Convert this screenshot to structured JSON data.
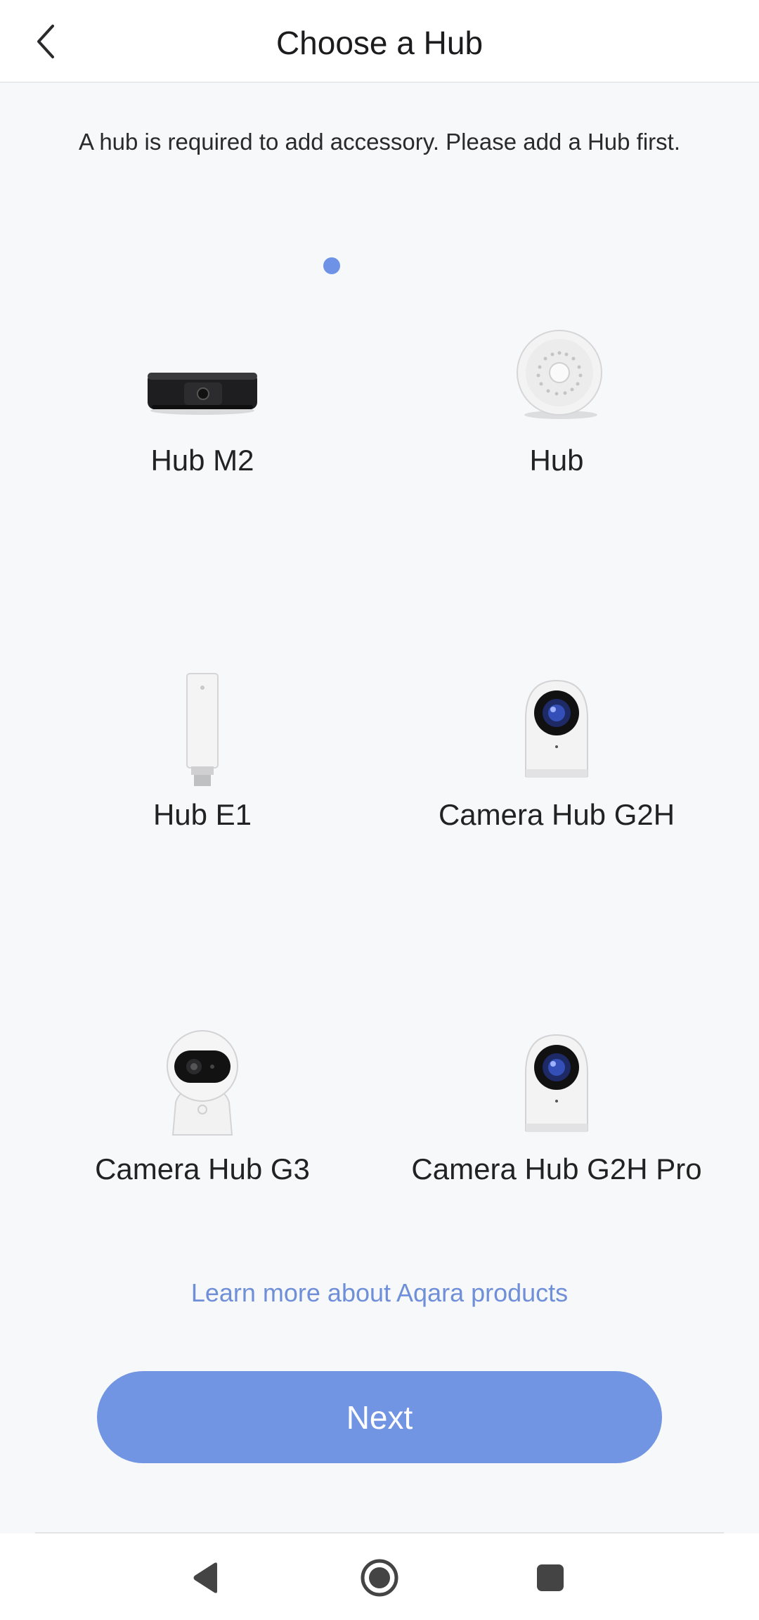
{
  "header": {
    "title": "Choose a Hub",
    "back_icon": "chevron-left-icon"
  },
  "notice": "A hub is required to add accessory. Please add a Hub first.",
  "hubs": [
    {
      "name": "Hub M2",
      "icon": "hub-m2-device-image",
      "selected": true
    },
    {
      "name": "Hub",
      "icon": "hub-device-image",
      "selected": false
    },
    {
      "name": "Hub E1",
      "icon": "hub-e1-dongle-image",
      "selected": false
    },
    {
      "name": "Camera Hub G2H",
      "icon": "camera-hub-g2h-image",
      "selected": false
    },
    {
      "name": "Camera Hub G3",
      "icon": "camera-hub-g3-image",
      "selected": false
    },
    {
      "name": "Camera Hub G2H Pro",
      "icon": "camera-hub-g2h-pro-image",
      "selected": false
    }
  ],
  "learn_more": "Learn more about Aqara products",
  "next_label": "Next",
  "system_nav": {
    "back_icon": "triangle-back-icon",
    "home_icon": "circle-home-icon",
    "recents_icon": "square-recents-icon"
  },
  "colors": {
    "accent": "#7195e3",
    "link": "#6f8fd8",
    "selection_dot": "#6e93e6"
  }
}
